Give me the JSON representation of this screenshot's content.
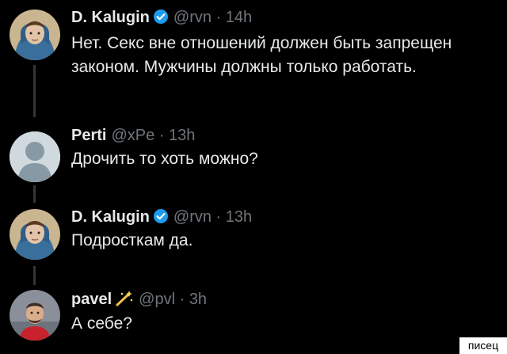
{
  "tweets": [
    {
      "name": "D. Kalugin",
      "handle": "@rvn",
      "time": "14h",
      "verified": true,
      "avatar": "user-photo-hooded",
      "text": "Нет. Секс вне отношений должен быть запрещен законом. Мужчины должны только работать."
    },
    {
      "name": "Perti",
      "handle": "@xPe",
      "time": "13h",
      "verified": false,
      "avatar": "default-profile-icon",
      "text": "Дрочить то хоть можно?"
    },
    {
      "name": "D. Kalugin",
      "handle": "@rvn",
      "time": "13h",
      "verified": true,
      "avatar": "user-photo-hooded",
      "text": "Подросткам да."
    },
    {
      "name": "pavel",
      "handle": "@pvl",
      "time": "3h",
      "verified": false,
      "badge": "sparkles-emoji",
      "avatar": "user-photo",
      "text": "А себе?"
    }
  ],
  "watermark": "писец",
  "colors": {
    "background": "#000000",
    "text": "#e7e9ea",
    "muted": "#71767b",
    "verified": "#1d9bf0",
    "thread_line": "#333639"
  }
}
